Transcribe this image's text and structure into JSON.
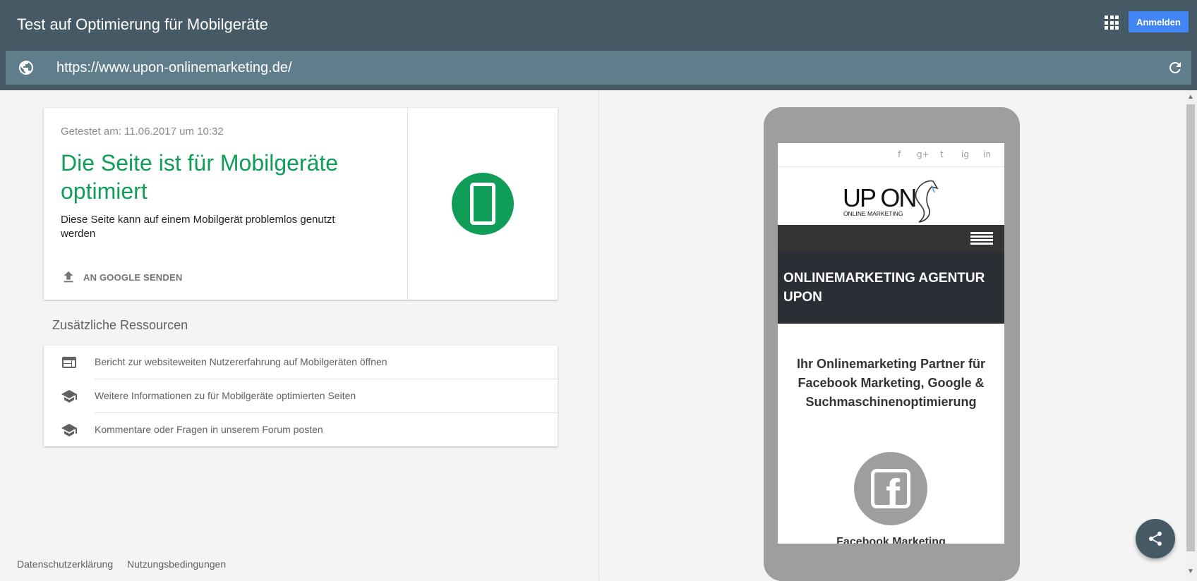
{
  "header": {
    "title": "Test auf Optimierung für Mobilgeräte",
    "signin_label": "Anmelden",
    "apps_icon": "apps-grid-icon"
  },
  "urlbar": {
    "url": "https://www.upon-onlinemarketing.de/",
    "globe_icon": "globe-icon",
    "refresh_icon": "refresh-icon"
  },
  "result": {
    "tested_at": "Getestet am: 11.06.2017 um 10:32",
    "title": "Die Seite ist für Mobilgeräte optimiert",
    "description": "Diese Seite kann auf einem Mobilgerät problemlos genutzt werden",
    "submit_label": "AN GOOGLE SENDEN",
    "status_color": "#0f9d58"
  },
  "resources": {
    "heading": "Zusätzliche Ressourcen",
    "items": [
      {
        "label": "Bericht zur websiteweiten Nutzererfahrung auf Mobilgeräten öffnen",
        "icon": "web-report-icon"
      },
      {
        "label": "Weitere Informationen zu für Mobilgeräte optimierten Seiten",
        "icon": "school-icon"
      },
      {
        "label": "Kommentare oder Fragen in unserem Forum posten",
        "icon": "school-icon"
      }
    ]
  },
  "footer": {
    "privacy": "Datenschutzerklärung",
    "terms": "Nutzungsbedingungen"
  },
  "preview": {
    "social_icons": [
      "f",
      "g+",
      "t",
      "ig",
      "in"
    ],
    "logo_main": "UP ON",
    "logo_sub": "ONLINE MARKETING",
    "hero_title": "ONLINEMARKETING AGENTUR UPON",
    "tagline": "Ihr Onlinemarketing Partner für Facebook Marketing, Google & Suchmaschinenoptimierung",
    "fb_caption": "Facebook Marketing",
    "fb_letter": "f"
  },
  "colors": {
    "header_bg": "#455a64",
    "urlbar_bg": "#607d8b",
    "signin_bg": "#4285f4"
  }
}
